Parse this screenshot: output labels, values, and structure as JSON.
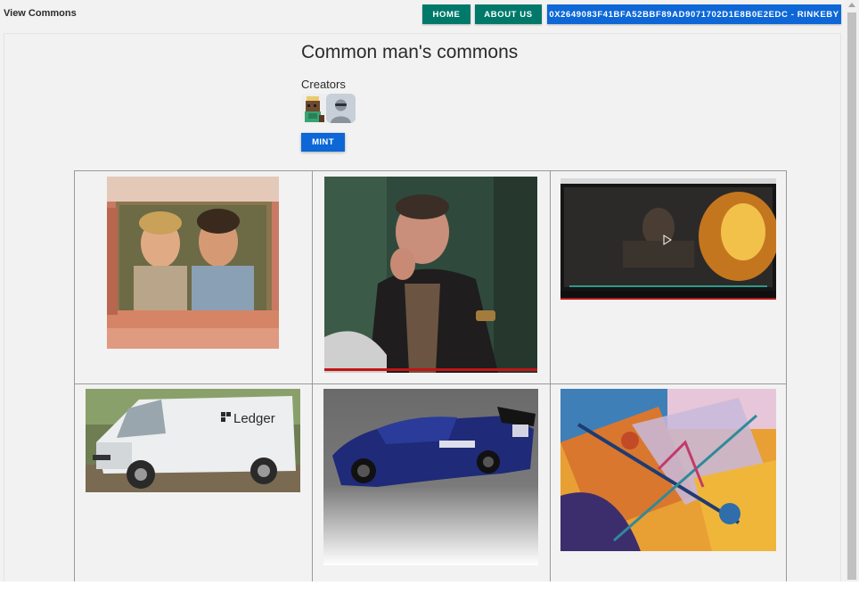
{
  "navbar": {
    "brand": "View Commons",
    "home_label": "HOME",
    "about_label": "ABOUT US",
    "wallet_label": "0X2649083F41BFA52BBF89AD9071702D1E8B0E2EDC - RINKEBY"
  },
  "commons": {
    "title": "Common man's commons",
    "creators_label": "Creators",
    "creators": [
      {
        "avatar": "pixel-character-avatar"
      },
      {
        "avatar": "default-user-avatar"
      }
    ],
    "mint_label": "MINT"
  },
  "gallery": {
    "items": [
      {
        "image": "two-men-in-car-photo"
      },
      {
        "image": "man-smoking-in-leather-jacket-photo"
      },
      {
        "image": "video-player-explosion-screenshot"
      },
      {
        "image": "ledger-delivery-van-photo"
      },
      {
        "image": "blue-race-car-render"
      },
      {
        "image": "colorful-abstract-painting"
      }
    ]
  },
  "colors": {
    "teal": "#00796b",
    "blue": "#0d67d6",
    "background": "#f2f2f2"
  }
}
